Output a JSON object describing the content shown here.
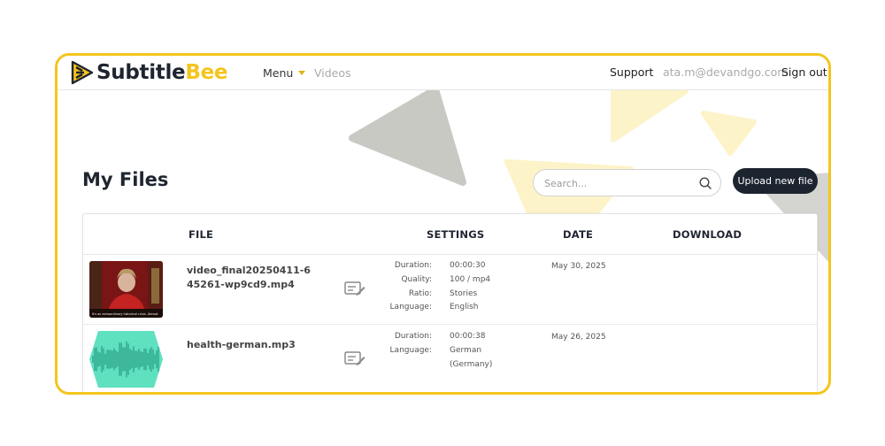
{
  "brand": {
    "name_part1": "Subtitle",
    "name_part2": "Bee",
    "accent": "#f4c51c",
    "dark": "#1f2530",
    "logo_icon": "bee-play-icon"
  },
  "nav": {
    "menu_label": "Menu",
    "videos_label": "Videos",
    "support_label": "Support",
    "user_email": "ata.m@devandgo.com",
    "signout_label": "Sign out"
  },
  "page": {
    "title": "My Files",
    "search_placeholder": "Search...",
    "search_icon": "search-icon",
    "upload_label": "Upload new file"
  },
  "table": {
    "columns": [
      "FILE",
      "SETTINGS",
      "DATE",
      "DOWNLOAD"
    ],
    "rows": [
      {
        "filename": "video_final20250411-645261-wp9cd9.mp4",
        "thumbnail": "video-thumbnail",
        "thumbnail_caption": "It's an extraordinary historical crisis. Almost",
        "edit_icon": "edit-subtitle-icon",
        "settings": [
          {
            "label": "Duration:",
            "value": "00:00:30"
          },
          {
            "label": "Quality:",
            "value": "100 / mp4"
          },
          {
            "label": "Ratio:",
            "value": "Stories"
          },
          {
            "label": "Language:",
            "value": "English"
          }
        ],
        "date": "May 30, 2025"
      },
      {
        "filename": "health-german.mp3",
        "thumbnail": "audio-waveform-thumbnail",
        "edit_icon": "edit-subtitle-icon",
        "settings": [
          {
            "label": "Duration:",
            "value": "00:00:38"
          },
          {
            "label": "Language:",
            "value": "German (Germany)"
          }
        ],
        "date": "May 26, 2025"
      }
    ]
  }
}
